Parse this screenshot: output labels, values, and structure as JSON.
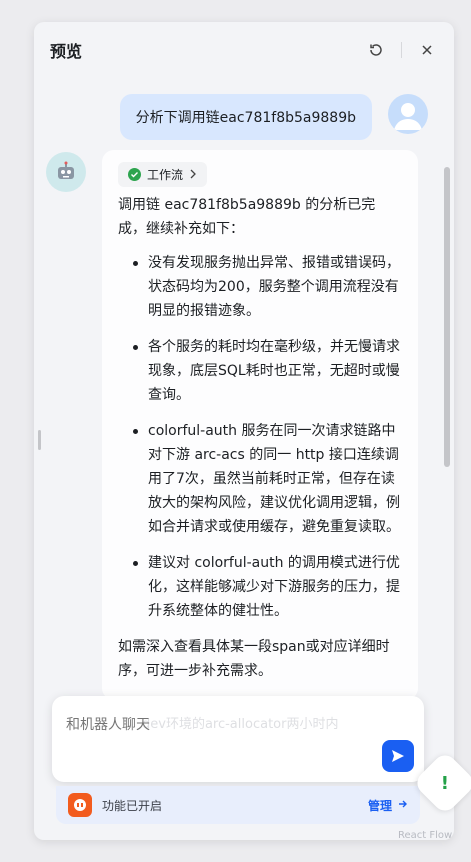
{
  "header": {
    "title": "预览"
  },
  "user_message": {
    "text": "分析下调用链eac781f8b5a9889b"
  },
  "bot_message": {
    "workflow_tag": "工作流",
    "intro": "调用链 eac781f8b5a9889b 的分析已完成，继续补充如下：",
    "bullets": [
      "没有发现服务抛出异常、报错或错误码，状态码均为200，服务整个调用流程没有明显的报错迹象。",
      "各个服务的耗时均在毫秒级，并无慢请求现象，底层SQL耗时也正常，无超时或慢查询。",
      "colorful-auth 服务在同一次请求链路中对下游 arc-acs 的同一 http 接口连续调用了7次，虽然当前耗时正常，但存在读放大的架构风险，建议优化调用逻辑，例如合并请求或使用缓存，避免重复读取。",
      "建议对 colorful-auth 的调用模式进行优化，这样能够减少对下游服务的压力，提升系统整体的健壮性。"
    ],
    "closing": "如需深入查看具体某一段span或对应详细时序，可进一步补充需求。"
  },
  "input": {
    "placeholder": "和机器人聊天",
    "ghost_text": "dev环境的arc-allocator两小时内"
  },
  "feature_bar": {
    "label": "功能已开启",
    "manage": "管理"
  },
  "corner": {
    "text": "React Flow"
  },
  "colors": {
    "accent": "#1a5ff2",
    "user_bubble": "#d8e7fe",
    "success": "#2da44e"
  }
}
